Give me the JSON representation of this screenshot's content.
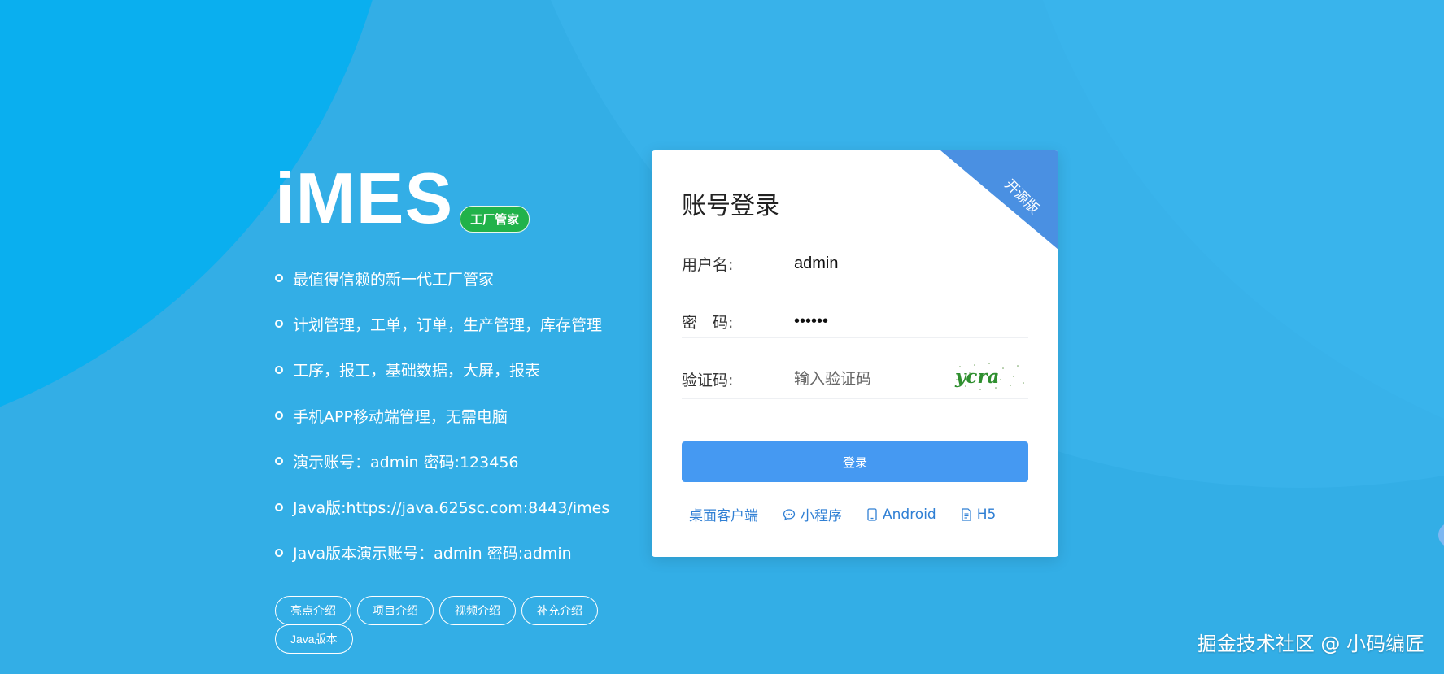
{
  "intro": {
    "logo": "iMES",
    "badge": "工厂管家",
    "features": [
      "最值得信赖的新一代工厂管家",
      "计划管理，工单，订单，生产管理，库存管理",
      "工序，报工，基础数据，大屏，报表",
      "手机APP移动端管理，无需电脑",
      "演示账号：admin 密码:123456",
      "Java版:https://java.625sc.com:8443/imes",
      "Java版本演示账号：admin 密码:admin"
    ],
    "pills": [
      "亮点介绍",
      "项目介绍",
      "视频介绍",
      "补充介绍",
      "Java版本"
    ]
  },
  "login": {
    "ribbon": "开源版",
    "title": "账号登录",
    "username_label": "用户名:",
    "username_value": "admin",
    "password_label": "密　码:",
    "password_value": "••••••",
    "captcha_label": "验证码:",
    "captcha_placeholder": "输入验证码",
    "captcha_text": "ycra",
    "button": "登录",
    "links": [
      "桌面客户端",
      "小程序",
      "Android",
      "H5"
    ]
  },
  "watermark": "掘金技术社区 @ 小码编匠",
  "colors": {
    "accent": "#4599f2",
    "badge": "#21b24a",
    "ribbon": "#4a90e2"
  }
}
